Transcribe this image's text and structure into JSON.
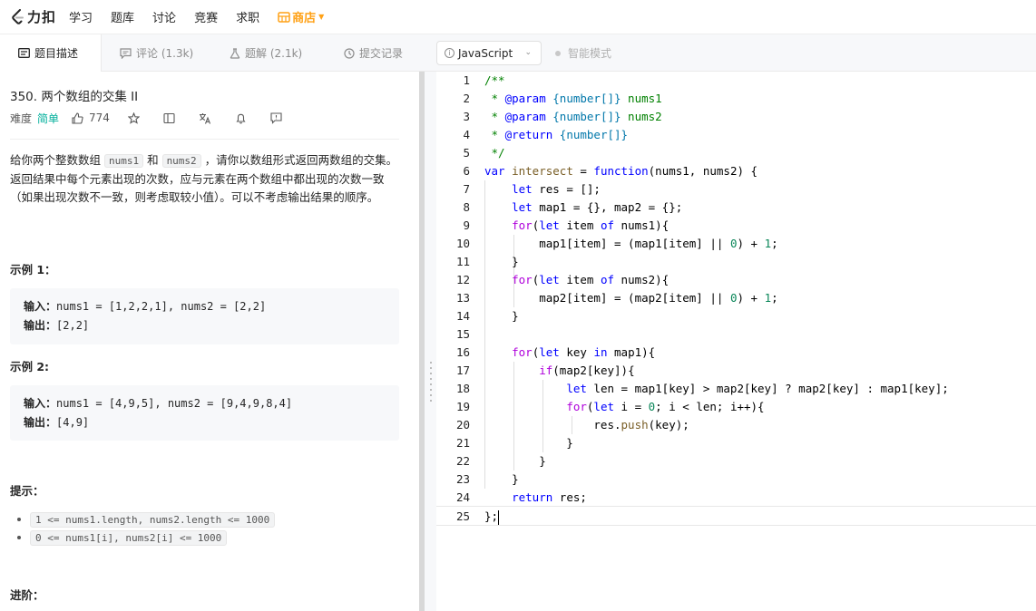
{
  "nav": {
    "logo_text": "力扣",
    "items": [
      "学习",
      "题库",
      "讨论",
      "竞赛",
      "求职"
    ],
    "shop": "商店"
  },
  "tabs": {
    "description": "题目描述",
    "comments": "评论 (1.3k)",
    "solutions": "题解 (2.1k)",
    "submissions": "提交记录"
  },
  "editor_toolbar": {
    "language": "JavaScript",
    "smart_mode": "智能模式"
  },
  "problem": {
    "title": "350. 两个数组的交集 II",
    "difficulty_label": "难度",
    "difficulty": "简单",
    "likes": "774",
    "description_parts": [
      "给你两个整数数组 ",
      "nums1",
      " 和 ",
      "nums2",
      " ，请你以数组形式返回两数组的交集。返回结果中每个元素出现的次数，应与元素在两个数组中都出现的次数一致（如果出现次数不一致，则考虑取较小值）。可以不考虑输出结果的顺序。"
    ],
    "example1_title": "示例 1：",
    "example1_input_label": "输入：",
    "example1_input": "nums1 = [1,2,2,1], nums2 = [2,2]",
    "example1_output_label": "输出：",
    "example1_output": "[2,2]",
    "example2_title": "示例 2:",
    "example2_input_label": "输入：",
    "example2_input": "nums1 = [4,9,5], nums2 = [9,4,9,8,4]",
    "example2_output_label": "输出：",
    "example2_output": "[4,9]",
    "hints_title": "提示：",
    "hints": [
      "1 <= nums1.length, nums2.length <= 1000",
      "0 <= nums1[i], nums2[i] <= 1000"
    ],
    "advanced_title": "进阶："
  },
  "code": {
    "line_numbers": [
      "1",
      "2",
      "3",
      "4",
      "5",
      "6",
      "7",
      "8",
      "9",
      "10",
      "11",
      "12",
      "13",
      "14",
      "15",
      "16",
      "17",
      "18",
      "19",
      "20",
      "21",
      "22",
      "23",
      "24",
      "25"
    ],
    "lines": [
      "/**",
      " * @param {number[]} nums1",
      " * @param {number[]} nums2",
      " * @return {number[]}",
      " */",
      "var intersect = function(nums1, nums2) {",
      "    let res = [];",
      "    let map1 = {}, map2 = {};",
      "    for(let item of nums1){",
      "        map1[item] = (map1[item] || 0) + 1;",
      "    }",
      "    for(let item of nums2){",
      "        map2[item] = (map2[item] || 0) + 1;",
      "    }",
      "",
      "    for(let key in map1){",
      "        if(map2[key]){",
      "            let len = map1[key] > map2[key] ? map2[key] : map1[key];",
      "            for(let i = 0; i < len; i++){",
      "                res.push(key);",
      "            }",
      "        }",
      "    }",
      "    return res;",
      "};"
    ]
  }
}
